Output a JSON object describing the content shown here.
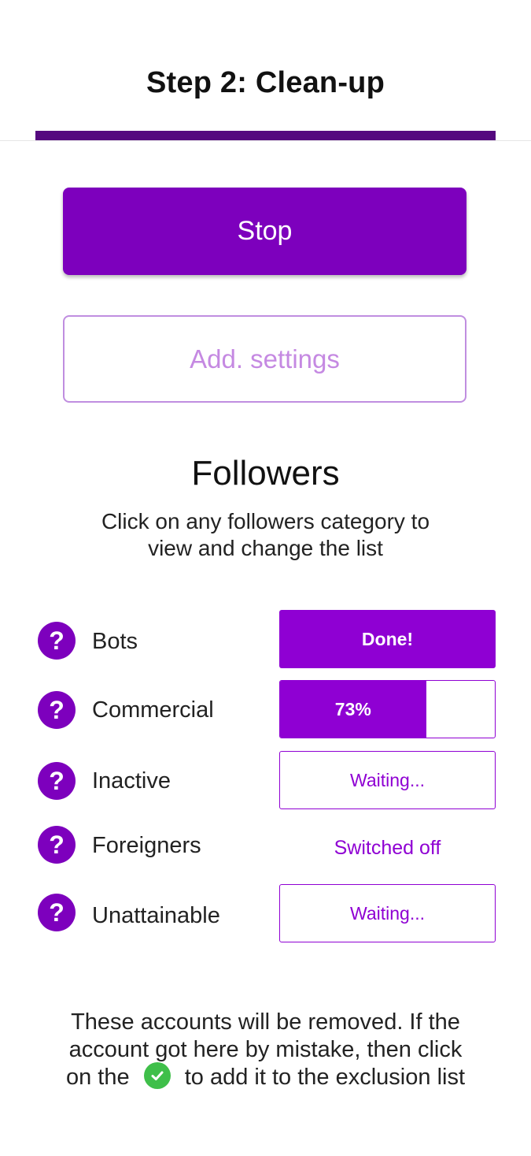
{
  "header": {
    "title": "Step 2: Clean-up",
    "step_progress": 1.0
  },
  "buttons": {
    "stop_label": "Stop",
    "settings_label": "Add. settings"
  },
  "followers": {
    "title": "Followers",
    "subtitle": "Click on any followers category to view and change the list",
    "categories": [
      {
        "label": "Bots",
        "status": "Done!",
        "state": "done"
      },
      {
        "label": "Commercial",
        "status": "73%",
        "state": "progress",
        "progress": 0.68
      },
      {
        "label": "Inactive",
        "status": "Waiting...",
        "state": "waiting"
      },
      {
        "label": "Foreigners",
        "status": "Switched off",
        "state": "off"
      },
      {
        "label": "Unattainable",
        "status": "Waiting...",
        "state": "waiting"
      }
    ]
  },
  "footer": {
    "note_before": "These accounts will be removed. If the account got here by mistake, then click on the",
    "note_after": "to add it to the exclusion list"
  },
  "colors": {
    "primary": "#7d00bd",
    "status_accent": "#8f00d3",
    "header_progress": "#55097f",
    "check_green": "#3fbf4a"
  },
  "icons": {
    "help": "question-mark-circle-icon",
    "check": "check-circle-icon"
  }
}
